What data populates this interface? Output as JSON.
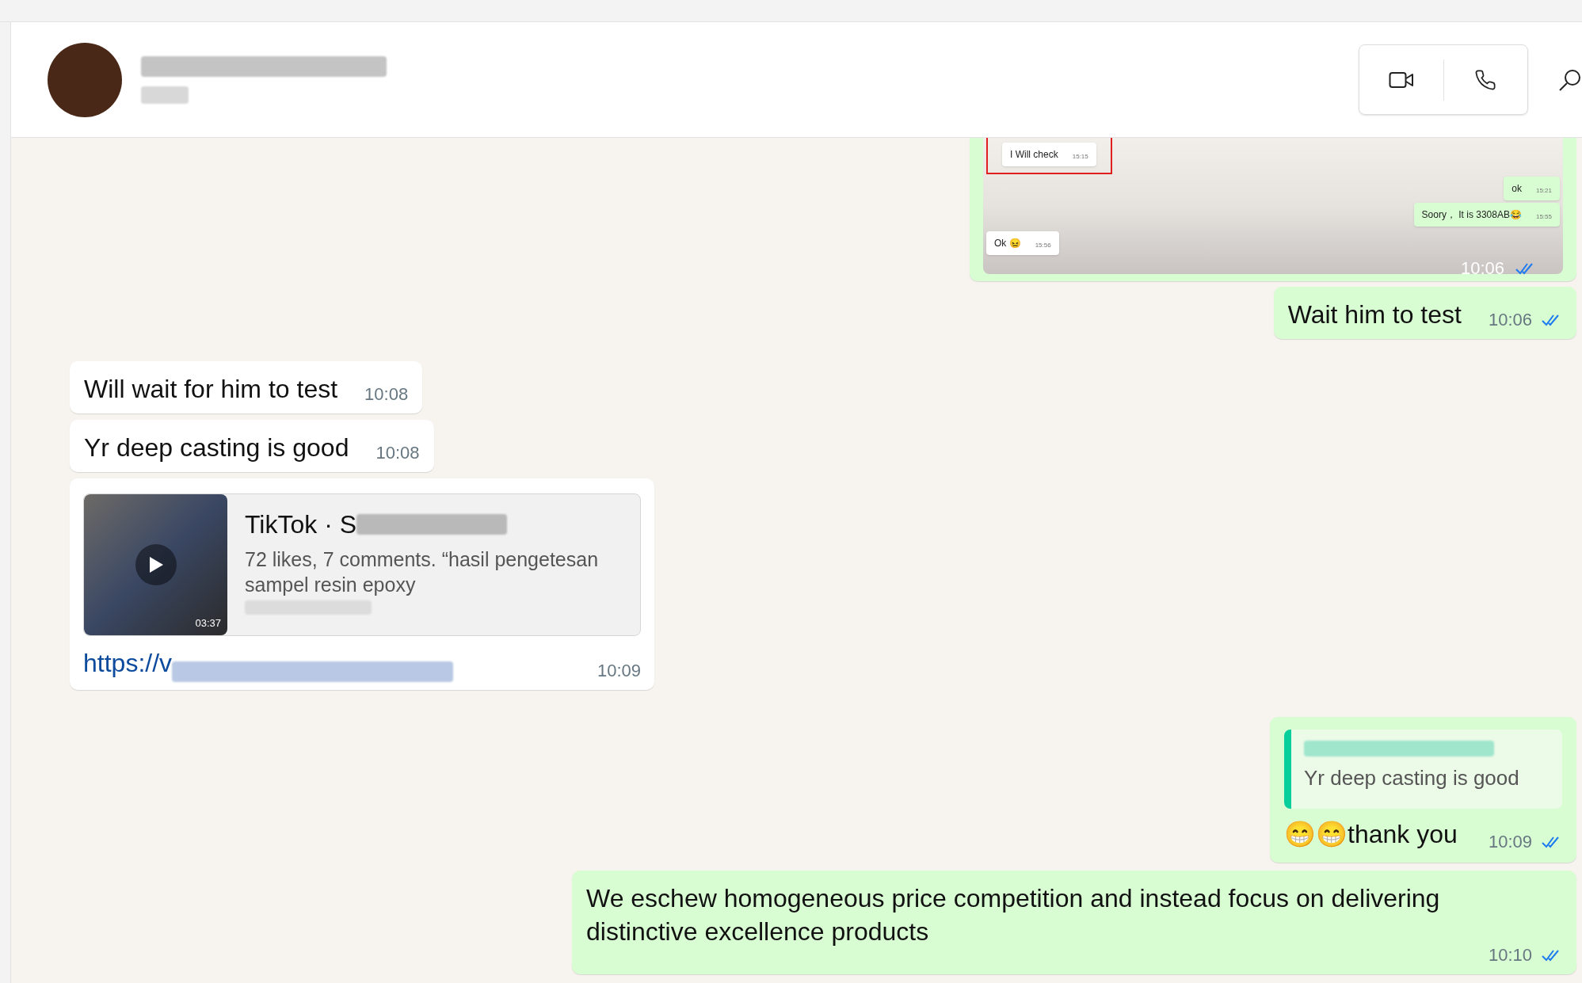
{
  "header": {
    "actions": [
      {
        "kind": "video"
      },
      {
        "kind": "call"
      }
    ],
    "search": {
      "kind": "search"
    }
  },
  "messages": [
    {
      "kind": "screenshot",
      "outgoing": true,
      "time": "10:06",
      "read": true,
      "inner_messages": [
        {
          "text": "I Will check",
          "time": "15:15",
          "outgoing": false,
          "highlighted": true
        },
        {
          "text": "ok",
          "time": "15:21",
          "outgoing": true,
          "highlighted": false
        },
        {
          "text": "Soory， It is 3308AB😂",
          "time": "15:55",
          "outgoing": true,
          "highlighted": false
        },
        {
          "text": "Ok 😖",
          "time": "15:56",
          "outgoing": false,
          "highlighted": false
        }
      ]
    },
    {
      "kind": "text",
      "outgoing": true,
      "text": "Wait him to test",
      "time": "10:06",
      "read": true
    },
    {
      "kind": "text",
      "outgoing": false,
      "text": "Will wait for him to test",
      "time": "10:08"
    },
    {
      "kind": "text",
      "outgoing": false,
      "text": "Yr deep casting is good",
      "time": "10:08"
    },
    {
      "kind": "link",
      "outgoing": false,
      "preview": {
        "duration": "03:37",
        "title": "TikTok · S",
        "description": "72 likes, 7 comments. “hasil pengetesan sampel resin epoxy"
      },
      "link": "https://v",
      "time": "10:09"
    },
    {
      "kind": "reply",
      "outgoing": true,
      "quote": "Yr deep casting is good",
      "text": "😁😁thank you",
      "time": "10:09",
      "read": true
    },
    {
      "kind": "text",
      "outgoing": true,
      "text": "We eschew homogeneous price competition and instead focus on delivering distinctive excellence products",
      "time": "10:10",
      "read": true
    }
  ]
}
